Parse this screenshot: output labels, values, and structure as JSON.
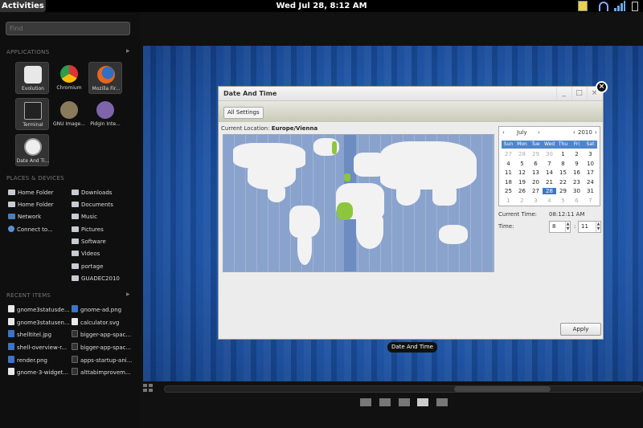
{
  "topbar": {
    "activities_label": "Activities",
    "clock": "Wed Jul 28,  8:12 AM"
  },
  "search": {
    "placeholder": "Find"
  },
  "applications": {
    "title": "APPLICATIONS",
    "items": [
      {
        "label": "Evolution",
        "icon": "evolution-icon"
      },
      {
        "label": "Chromium",
        "icon": "chromium-icon"
      },
      {
        "label": "Mozilla Fir...",
        "icon": "firefox-icon"
      },
      {
        "label": "Terminal",
        "icon": "terminal-icon"
      },
      {
        "label": "GNU Image...",
        "icon": "gimp-icon"
      },
      {
        "label": "Pidgin Inte...",
        "icon": "pidgin-icon"
      },
      {
        "label": "Date And Ti...",
        "icon": "clock-icon"
      }
    ]
  },
  "places": {
    "title": "PLACES & DEVICES",
    "left": [
      "Home Folder",
      "Home Folder",
      "Network",
      "Connect to..."
    ],
    "right": [
      "Downloads",
      "Documents",
      "Music",
      "Pictures",
      "Software",
      "Videos",
      "portage",
      "GUADEC2010"
    ]
  },
  "recent": {
    "title": "RECENT ITEMS",
    "left": [
      "gnome3statusde...",
      "gnome3statusen...",
      "shelltitel.jpg",
      "shell-overview-r...",
      "render.png",
      "gnome-3-widget..."
    ],
    "right": [
      "gnome-ad.png",
      "calculator.svg",
      "bigger-app-spac...",
      "bigger-app-spac...",
      "apps-startup-ani...",
      "alttabimprovem..."
    ]
  },
  "window": {
    "title": "Date And Time",
    "all_settings": "All Settings",
    "location_label": "Current Location:",
    "location_value": "Europe/Vienna",
    "caption": "Date And Time",
    "apply": "Apply",
    "current_time_label": "Current Time:",
    "current_time_value": "08:12:11 AM",
    "time_label": "Time:",
    "hour": "8",
    "minute": "11",
    "colon": ":"
  },
  "calendar": {
    "month": "July",
    "year": "2010",
    "prev": "‹",
    "next": "›",
    "weekdays": [
      "Sun",
      "Mon",
      "Tue",
      "Wed",
      "Thu",
      "Fri",
      "Sat"
    ],
    "weeks": [
      [
        "27",
        "28",
        "29",
        "30",
        "1",
        "2",
        "3"
      ],
      [
        "4",
        "5",
        "6",
        "7",
        "8",
        "9",
        "10"
      ],
      [
        "11",
        "12",
        "13",
        "14",
        "15",
        "16",
        "17"
      ],
      [
        "18",
        "19",
        "20",
        "21",
        "22",
        "23",
        "24"
      ],
      [
        "25",
        "26",
        "27",
        "28",
        "29",
        "30",
        "31"
      ],
      [
        "1",
        "2",
        "3",
        "4",
        "5",
        "6",
        "7"
      ]
    ],
    "selected": "28"
  },
  "colors": {
    "accent": "#3f78c2",
    "desktop": "#1f58ad",
    "map_water": "#8aa3cd"
  }
}
